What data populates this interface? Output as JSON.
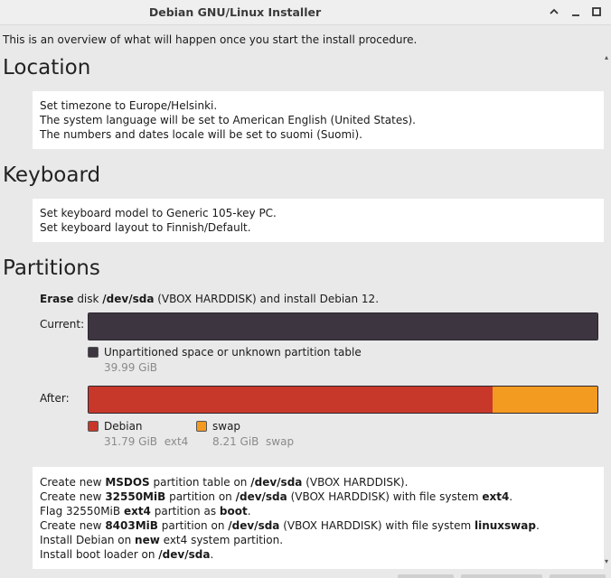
{
  "window": {
    "title": "Debian GNU/Linux Installer",
    "controls": {
      "up_icon": "chevron-up-icon",
      "minimize_icon": "minimize-icon",
      "maximize_icon": "maximize-icon"
    }
  },
  "intro": "This is an overview of what will happen once you start the install procedure.",
  "location": {
    "heading": "Location",
    "lines": [
      "Set timezone to Europe/Helsinki.",
      "The system language will be set to American English (United States).",
      "The numbers and dates locale will be set to suomi (Suomi)."
    ]
  },
  "keyboard": {
    "heading": "Keyboard",
    "lines": [
      "Set keyboard model to Generic 105-key PC.",
      "Set keyboard layout to Finnish/Default."
    ]
  },
  "partitions": {
    "heading": "Partitions",
    "erase": {
      "b1": "Erase",
      "t1": " disk ",
      "b2": "/dev/sda",
      "t2": " (VBOX HARDDISK) and install Debian 12."
    },
    "current": {
      "label": "Current:",
      "legend": {
        "name": "Unpartitioned space or unknown partition table",
        "size": "39.99 GiB",
        "color": "#3d3540"
      }
    },
    "after": {
      "label": "After:",
      "segments": [
        {
          "name": "Debian",
          "size": "31.79 GiB",
          "fs": "ext4",
          "color": "#c8382a",
          "fraction": 0.7948
        },
        {
          "name": "swap",
          "size": "8.21 GiB",
          "fs": "swap",
          "color": "#f39a21",
          "fraction": 0.2052
        }
      ]
    },
    "operations": {
      "l1": {
        "t1": "Create new ",
        "b1": "MSDOS",
        "t2": " partition table on ",
        "b2": "/dev/sda",
        "t3": " (VBOX HARDDISK)."
      },
      "l2": {
        "t1": "Create new ",
        "b1": "32550MiB",
        "t2": " partition on ",
        "b2": "/dev/sda",
        "t3": " (VBOX HARDDISK) with file system ",
        "b3": "ext4",
        "t4": "."
      },
      "l3": {
        "t1": "Flag 32550MiB ",
        "b1": "ext4",
        "t2": " partition as ",
        "b2": "boot",
        "t3": "."
      },
      "l4": {
        "t1": "Create new ",
        "b1": "8403MiB",
        "t2": " partition on ",
        "b2": "/dev/sda",
        "t3": " (VBOX HARDDISK) with file system ",
        "b3": "linuxswap",
        "t4": "."
      },
      "l5": {
        "t1": "Install Debian on ",
        "b1": "new",
        "t2": " ext4 system partition."
      },
      "l6": {
        "t1": "Install boot loader on ",
        "b1": "/dev/sda",
        "t2": "."
      }
    }
  }
}
